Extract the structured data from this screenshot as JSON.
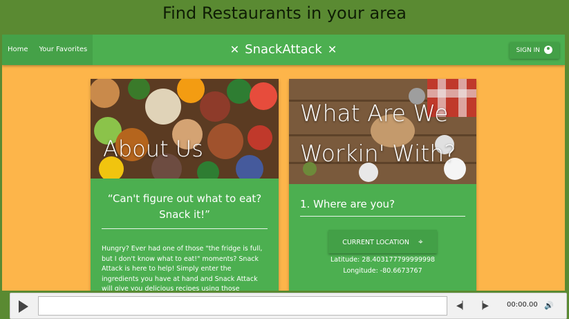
{
  "slide_title": "Find Restaurants in your area",
  "nav": {
    "links": [
      "Home",
      "Your Favorites"
    ],
    "brand": "SnackAttack",
    "signin": "SIGN IN"
  },
  "about": {
    "image_title": "About Us",
    "quote_line1": "“Can't figure out what to eat?",
    "quote_line2": "Snack it!”",
    "body": "Hungry? Ever had one of those \"the fridge is full, but I don't know what to eat!\" moments? Snack Attack is here to help! Simply enter the ingredients you have at hand and Snack Attack will give you delicious recipes using those ingredients. Decided you don't"
  },
  "working": {
    "image_title_line1": "What Are We",
    "image_title_line2": "Workin' With?",
    "step": "1. Where are you?",
    "button": "CURRENT LOCATION",
    "latitude": "Latitude: 28.403177799999998",
    "longitude": "Longitude: -80.6673767"
  },
  "player": {
    "time": "00:00.00"
  },
  "colors": {
    "slide_green": "#5a8a32",
    "site_orange": "#fdb54a",
    "card_green": "#4caf50"
  }
}
